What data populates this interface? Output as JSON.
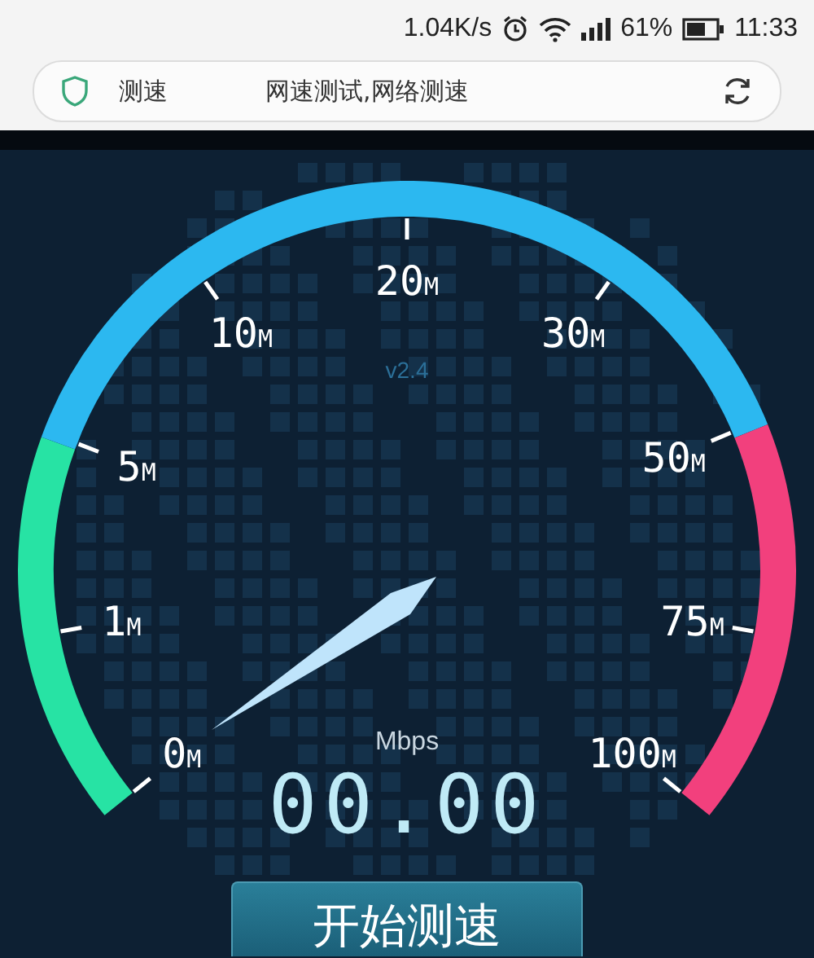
{
  "status_bar": {
    "net_speed": "1.04K/s",
    "battery": "61%",
    "time": "11:33"
  },
  "address_bar": {
    "title_parts": [
      "测速",
      "网速测试,网络测速"
    ]
  },
  "gauge": {
    "version": "v2.4",
    "ticks": [
      {
        "value": "0",
        "unit": "M"
      },
      {
        "value": "1",
        "unit": "M"
      },
      {
        "value": "5",
        "unit": "M"
      },
      {
        "value": "10",
        "unit": "M"
      },
      {
        "value": "20",
        "unit": "M"
      },
      {
        "value": "30",
        "unit": "M"
      },
      {
        "value": "50",
        "unit": "M"
      },
      {
        "value": "75",
        "unit": "M"
      },
      {
        "value": "100",
        "unit": "M"
      }
    ],
    "unit": "Mbps",
    "reading": "00.00"
  },
  "start_button": {
    "label": "开始测速"
  }
}
